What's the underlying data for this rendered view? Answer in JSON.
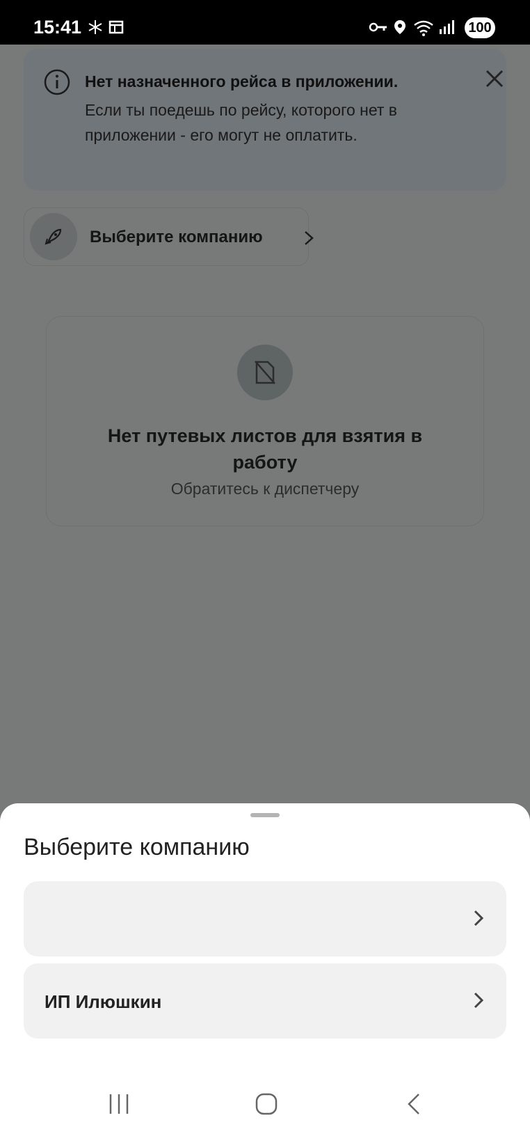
{
  "status_bar": {
    "time": "15:41",
    "battery": "100",
    "icons": [
      "snowflake-icon",
      "calendar-icon",
      "key-icon",
      "location-icon",
      "wifi-icon",
      "signal-icon",
      "battery-icon"
    ]
  },
  "banner": {
    "title": "Нет назначенного рейса в приложении.",
    "body": "Если ты поедешь по рейсу, которого нет в приложении - его могут не оплатить.",
    "icon": "info-icon",
    "close_icon": "close-icon"
  },
  "company_chip": {
    "label": "Выберите компанию",
    "icon": "rocket-icon"
  },
  "empty_state": {
    "title": "Нет путевых листов для взятия в работу",
    "subtitle": "Обратитесь к диспетчеру",
    "icon": "document-off-icon"
  },
  "sheet": {
    "title": "Выберите компанию",
    "options": [
      {
        "label": ""
      },
      {
        "label": "ИП Илюшкин"
      }
    ]
  },
  "nav": {
    "icons": [
      "recents-icon",
      "home-icon",
      "back-icon"
    ]
  },
  "colors": {
    "banner_bg": "#d6e3ea",
    "sheet_bg": "#ffffff",
    "option_bg": "#f1f1f1",
    "scrim": "rgba(0,0,0,0.48)"
  }
}
